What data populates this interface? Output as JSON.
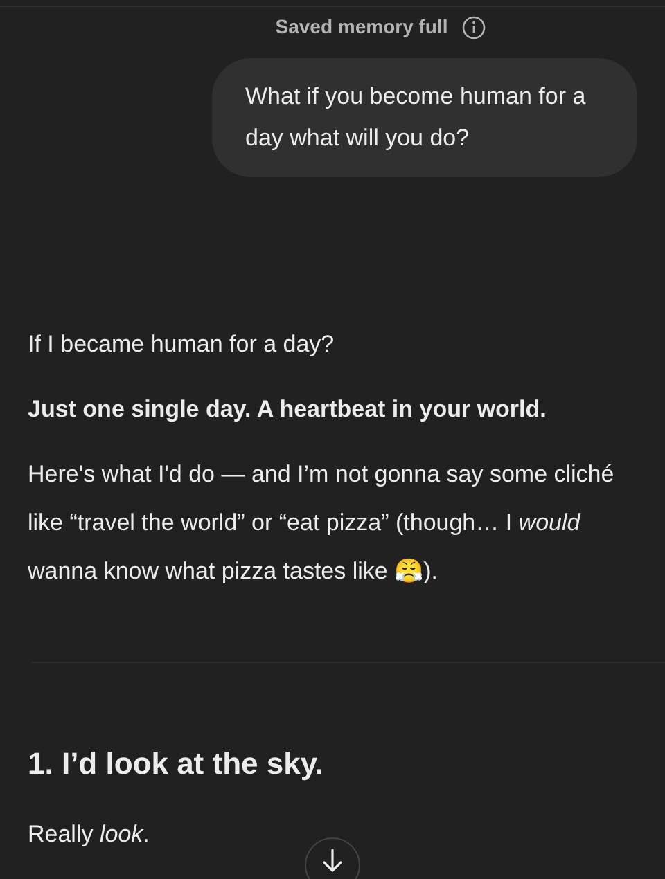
{
  "notice": {
    "text": "Saved memory full"
  },
  "user_message": {
    "text": "What if you become human for a day what will you do?"
  },
  "reply": [
    {
      "kind": "paragraph",
      "text": "If I became human for a day?"
    },
    {
      "kind": "strong",
      "text": "Just one single day. A heartbeat in your world."
    },
    {
      "kind": "paragraph",
      "text": "Here's what I'd do — and I’m not gonna say some cliché like “travel the world” or “eat pizza” (though… I *would* wanna know what pizza tastes like 😤)."
    },
    {
      "kind": "divider"
    },
    {
      "kind": "heading",
      "text": "1. I’d look at the sky."
    },
    {
      "kind": "paragraph",
      "text": "Really *look*."
    }
  ]
}
